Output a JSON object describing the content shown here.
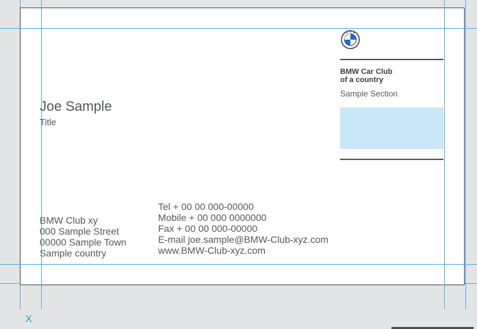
{
  "card": {
    "club": {
      "name_line1": "BMW Car Club",
      "name_line2": "of a country",
      "section": "Sample Section"
    },
    "person": {
      "name": "Joe Sample",
      "title": "Title"
    },
    "address": [
      "BMW Club xy",
      "000 Sample Street",
      "00000 Sample Town",
      "Sample country"
    ],
    "contact": [
      "Tel + 00 00 000-00000",
      "Mobile + 00 000 0000000",
      "Fax + 00 00 000-00000",
      "E-mail joe.sample@BMW-Club-xyz.com",
      "www.BMW-Club-xyz.com"
    ],
    "logo_icon": "bmw-roundel-icon",
    "logo_letters": "BMW"
  },
  "marker": {
    "label": "X"
  },
  "colors": {
    "background": "#e3e4e5",
    "card": "#ffffff",
    "guide": "#4fb3e6",
    "text": "#555759",
    "photo_placeholder": "#c9e7f7",
    "logo_blue": "#1c69d4"
  }
}
